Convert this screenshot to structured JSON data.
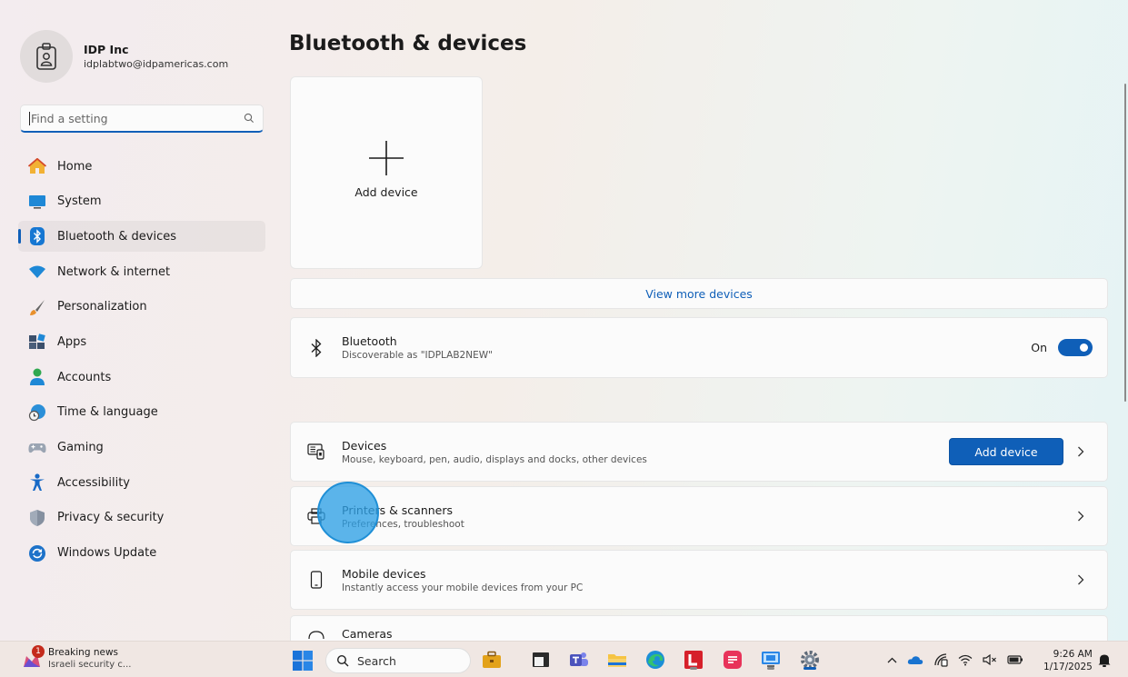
{
  "profile": {
    "name": "IDP Inc",
    "email": "idplabtwo@idpamericas.com"
  },
  "search": {
    "placeholder": "Find a setting"
  },
  "nav": {
    "items": [
      {
        "label": "Home",
        "icon": "home-icon"
      },
      {
        "label": "System",
        "icon": "system-icon"
      },
      {
        "label": "Bluetooth & devices",
        "icon": "bluetooth-icon",
        "active": true
      },
      {
        "label": "Network & internet",
        "icon": "wifi-icon"
      },
      {
        "label": "Personalization",
        "icon": "brush-icon"
      },
      {
        "label": "Apps",
        "icon": "apps-icon"
      },
      {
        "label": "Accounts",
        "icon": "accounts-icon"
      },
      {
        "label": "Time & language",
        "icon": "globe-clock-icon"
      },
      {
        "label": "Gaming",
        "icon": "gamepad-icon"
      },
      {
        "label": "Accessibility",
        "icon": "accessibility-icon"
      },
      {
        "label": "Privacy & security",
        "icon": "shield-icon"
      },
      {
        "label": "Windows Update",
        "icon": "update-icon"
      }
    ]
  },
  "main": {
    "title": "Bluetooth & devices",
    "add_tile_label": "Add device",
    "view_more": "View more devices",
    "bluetooth": {
      "title": "Bluetooth",
      "subtitle": "Discoverable as \"IDPLAB2NEW\"",
      "state_label": "On",
      "enabled": true
    },
    "devices": {
      "title": "Devices",
      "subtitle": "Mouse, keyboard, pen, audio, displays and docks, other devices",
      "button": "Add device"
    },
    "printers": {
      "title": "Printers & scanners",
      "subtitle": "Preferences, troubleshoot"
    },
    "mobile": {
      "title": "Mobile devices",
      "subtitle": "Instantly access your mobile devices from your PC"
    },
    "cameras": {
      "title": "Cameras"
    }
  },
  "taskbar": {
    "news_badge": "1",
    "news_title": "Breaking news",
    "news_sub": "Israeli security c...",
    "search_label": "Search",
    "time": "9:26 AM",
    "date": "1/17/2025"
  },
  "colors": {
    "accent": "#0f5fb8",
    "click_marker": "#2ea0e6"
  }
}
